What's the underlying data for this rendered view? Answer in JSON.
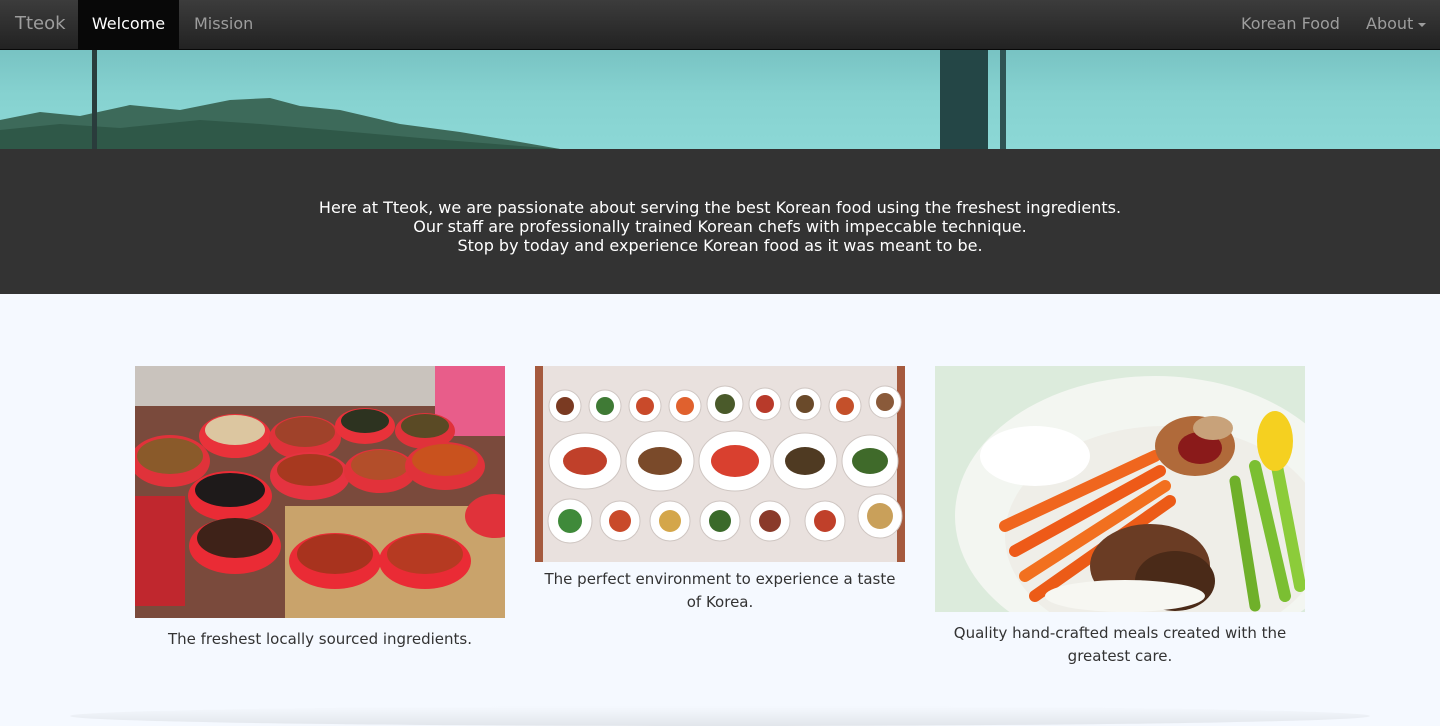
{
  "navbar": {
    "brand": "Tteok",
    "left_items": [
      {
        "label": "Welcome",
        "active": true
      },
      {
        "label": "Mission",
        "active": false
      }
    ],
    "right_items": [
      {
        "label": "Korean Food"
      },
      {
        "label": "About",
        "dropdown": true
      }
    ]
  },
  "intro": {
    "lines": [
      "Here at Tteok, we are passionate about serving the best Korean food using the freshest ingredients.",
      "Our staff are professionally trained Korean chefs with impeccable technique.",
      "Stop by today and experience Korean food as it was meant to be."
    ]
  },
  "features": [
    {
      "caption": "The freshest locally sourced ingredients."
    },
    {
      "caption": "The perfect environment to experience a taste of Korea."
    },
    {
      "caption": "Quality hand-crafted meals created with the greatest care."
    }
  ],
  "colors": {
    "navbar_bg": "#222222",
    "nav_active_bg": "#080808",
    "intro_bg": "#333333",
    "page_bg": "#f5f9ff"
  }
}
